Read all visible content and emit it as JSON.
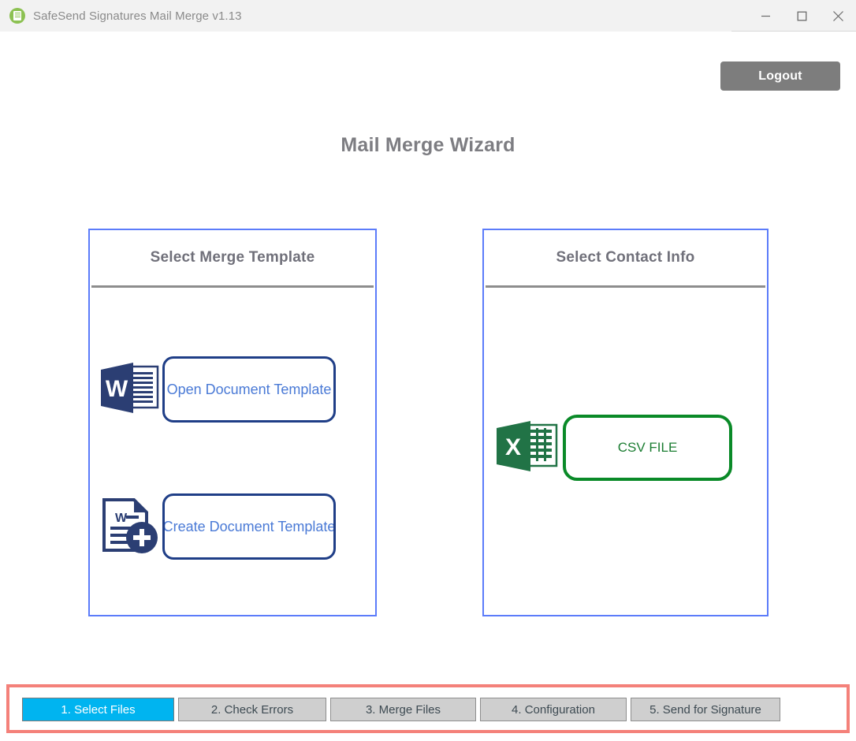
{
  "window": {
    "title": "SafeSend Signatures Mail Merge v1.13",
    "app_icon": "safesend-document-icon",
    "controls": {
      "minimize": "minimize-icon",
      "maximize": "maximize-icon",
      "close": "close-icon"
    }
  },
  "header": {
    "logout_label": "Logout",
    "page_title": "Mail Merge Wizard"
  },
  "panels": [
    {
      "id": "select-merge-template",
      "title": "Select Merge Template",
      "options": [
        {
          "id": "open-document-template",
          "label": "Open Document Template",
          "icon": "word-document-icon"
        },
        {
          "id": "create-document-template",
          "label": "Create Document Template",
          "icon": "word-document-add-icon"
        }
      ]
    },
    {
      "id": "select-contact-info",
      "title": "Select Contact Info",
      "options": [
        {
          "id": "csv-file",
          "label": "CSV FILE",
          "icon": "excel-spreadsheet-icon"
        }
      ]
    }
  ],
  "steps": [
    {
      "label": "1. Select Files",
      "active": true
    },
    {
      "label": "2. Check Errors",
      "active": false
    },
    {
      "label": "3. Merge Files",
      "active": false
    },
    {
      "label": "4. Configuration",
      "active": false
    },
    {
      "label": "5. Send for Signature",
      "active": false
    }
  ],
  "colors": {
    "accent_blue": "#5c7cfa",
    "active_step": "#00b4f0",
    "highlight_red": "#f4817a",
    "word_navy": "#2b3e73",
    "excel_green": "#217346",
    "logout_gray": "#7d7d7d"
  }
}
